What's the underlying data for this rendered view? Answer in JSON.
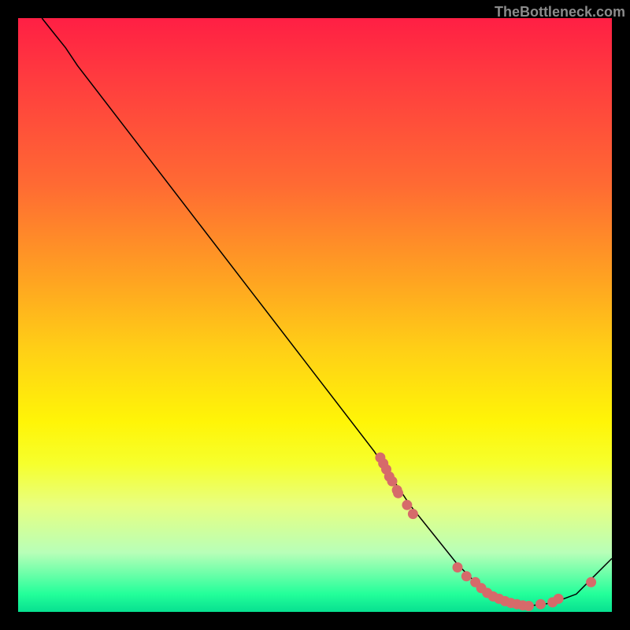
{
  "attribution": "TheBottleneck.com",
  "chart_data": {
    "type": "line",
    "title": "",
    "xlabel": "",
    "ylabel": "",
    "xlim": [
      0,
      100
    ],
    "ylim": [
      0,
      100
    ],
    "grid": false,
    "legend": false,
    "series": [
      {
        "name": "curve",
        "x": [
          4,
          6,
          8,
          10,
          20,
          30,
          40,
          50,
          60,
          66,
          70,
          74,
          78,
          82,
          86,
          90,
          94,
          96,
          100
        ],
        "y": [
          100,
          97.5,
          95,
          92,
          79,
          66,
          53,
          40,
          27,
          18,
          13,
          8,
          4,
          2,
          1,
          1.5,
          3,
          5,
          9
        ],
        "color": "#000000"
      }
    ],
    "points": {
      "name": "markers",
      "color": "#d66a6a",
      "xy": [
        [
          61,
          26
        ],
        [
          61.5,
          25
        ],
        [
          62,
          24
        ],
        [
          62.5,
          22.8
        ],
        [
          63,
          22
        ],
        [
          63.8,
          20.5
        ],
        [
          64,
          20
        ],
        [
          65.5,
          18
        ],
        [
          66.5,
          16.5
        ],
        [
          74,
          7.5
        ],
        [
          75.5,
          6
        ],
        [
          77,
          5
        ],
        [
          78,
          4
        ],
        [
          79,
          3.2
        ],
        [
          80,
          2.6
        ],
        [
          81,
          2.2
        ],
        [
          82,
          1.8
        ],
        [
          83,
          1.5
        ],
        [
          84,
          1.3
        ],
        [
          85,
          1.1
        ],
        [
          86,
          1
        ],
        [
          88,
          1.3
        ],
        [
          90,
          1.6
        ],
        [
          91,
          2.2
        ],
        [
          96.5,
          5
        ]
      ]
    }
  }
}
